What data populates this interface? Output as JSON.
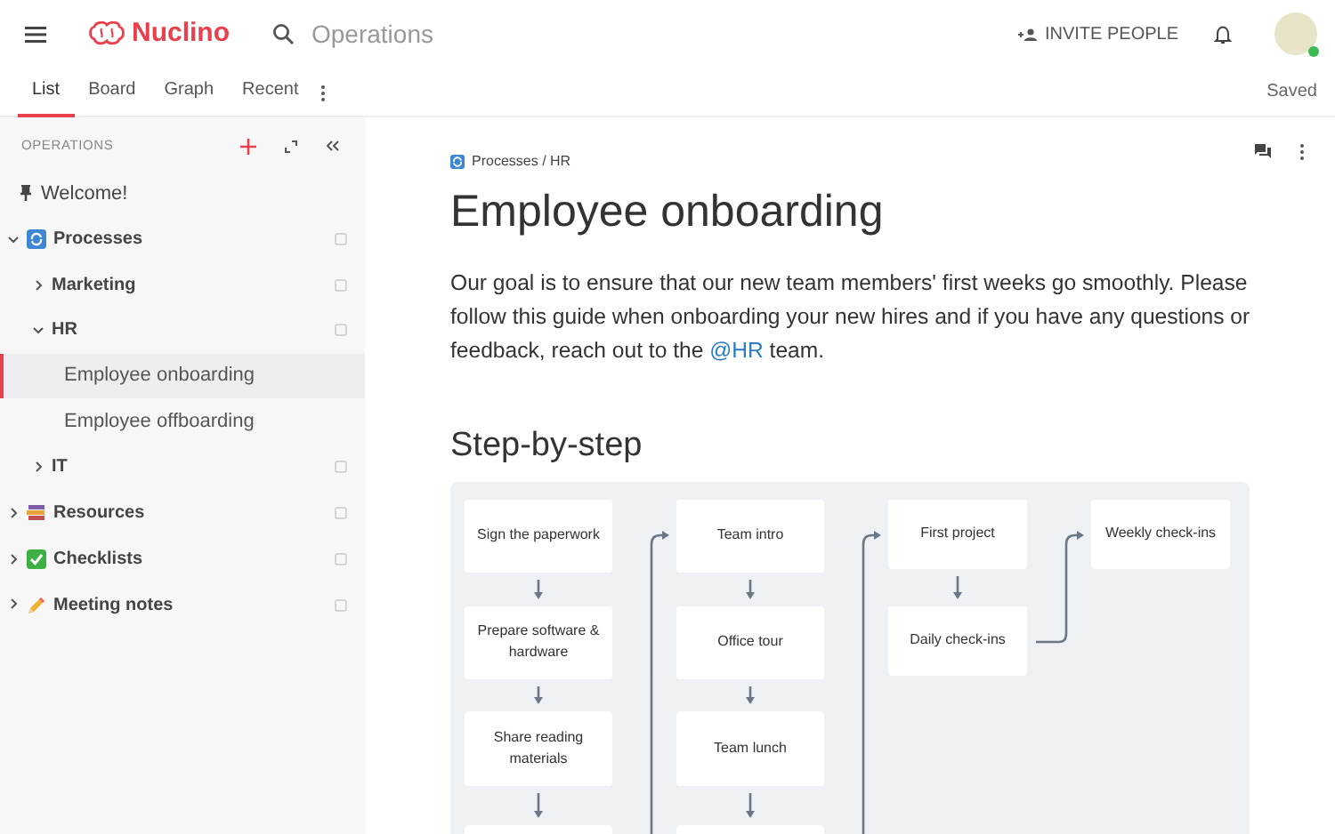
{
  "header": {
    "logo": "Nuclino",
    "search_placeholder": "Operations",
    "invite_button": "INVITE PEOPLE",
    "user_online": true
  },
  "tabs": [
    {
      "label": "List",
      "selected": true
    },
    {
      "label": "Board",
      "selected": false
    },
    {
      "label": "Graph",
      "selected": false
    },
    {
      "label": "Recent",
      "selected": false
    }
  ],
  "save_status": "Saved",
  "sidebar": {
    "title": "OPERATIONS",
    "items": [
      {
        "label": "Welcome!",
        "kind": "pin",
        "selected": false
      },
      {
        "label": "Processes",
        "kind": "cycle",
        "selected": false,
        "expanded": true,
        "children": [
          {
            "label": "Marketing",
            "selected": false,
            "expanded": false
          },
          {
            "label": "HR",
            "selected": false,
            "expanded": true,
            "children": [
              {
                "label": "Employee onboarding",
                "kind": "leaf",
                "selected": true
              },
              {
                "label": "Employee offboarding",
                "kind": "leaf",
                "selected": false
              }
            ]
          },
          {
            "label": "IT",
            "selected": false,
            "expanded": false
          }
        ]
      },
      {
        "label": "Resources",
        "kind": "books",
        "selected": false,
        "expanded": false
      },
      {
        "label": "Checklists",
        "kind": "check",
        "selected": false,
        "expanded": false
      },
      {
        "label": "Meeting notes",
        "kind": "pencil",
        "selected": false,
        "expanded": false
      }
    ]
  },
  "document": {
    "breadcrumb": "Processes / HR",
    "title": "Employee onboarding",
    "intro": {
      "text_before": "Our goal is to ensure that our new team members' first weeks go smoothly. Please follow this guide when onboarding your new hires and if you have any questions or feedback, reach out to the ",
      "mention": "@HR",
      "text_after": " team."
    },
    "heading": "Step-by-step",
    "flow": [
      [
        {
          "kind": "step",
          "label": "Sign the paperwork"
        },
        {
          "kind": "step",
          "label": "Prepare software & hardware"
        },
        {
          "kind": "step",
          "label": "Share reading materials"
        },
        {
          "kind": "cut"
        }
      ],
      [
        {
          "kind": "step",
          "label": "Team intro"
        },
        {
          "kind": "step",
          "label": "Office tour"
        },
        {
          "kind": "step",
          "label": "Team lunch"
        },
        {
          "kind": "cut"
        }
      ],
      [
        {
          "kind": "step",
          "label": "First project"
        },
        {
          "kind": "step",
          "label": "Daily check-ins"
        }
      ],
      [
        {
          "kind": "step",
          "label": "Weekly check-ins"
        }
      ]
    ]
  }
}
